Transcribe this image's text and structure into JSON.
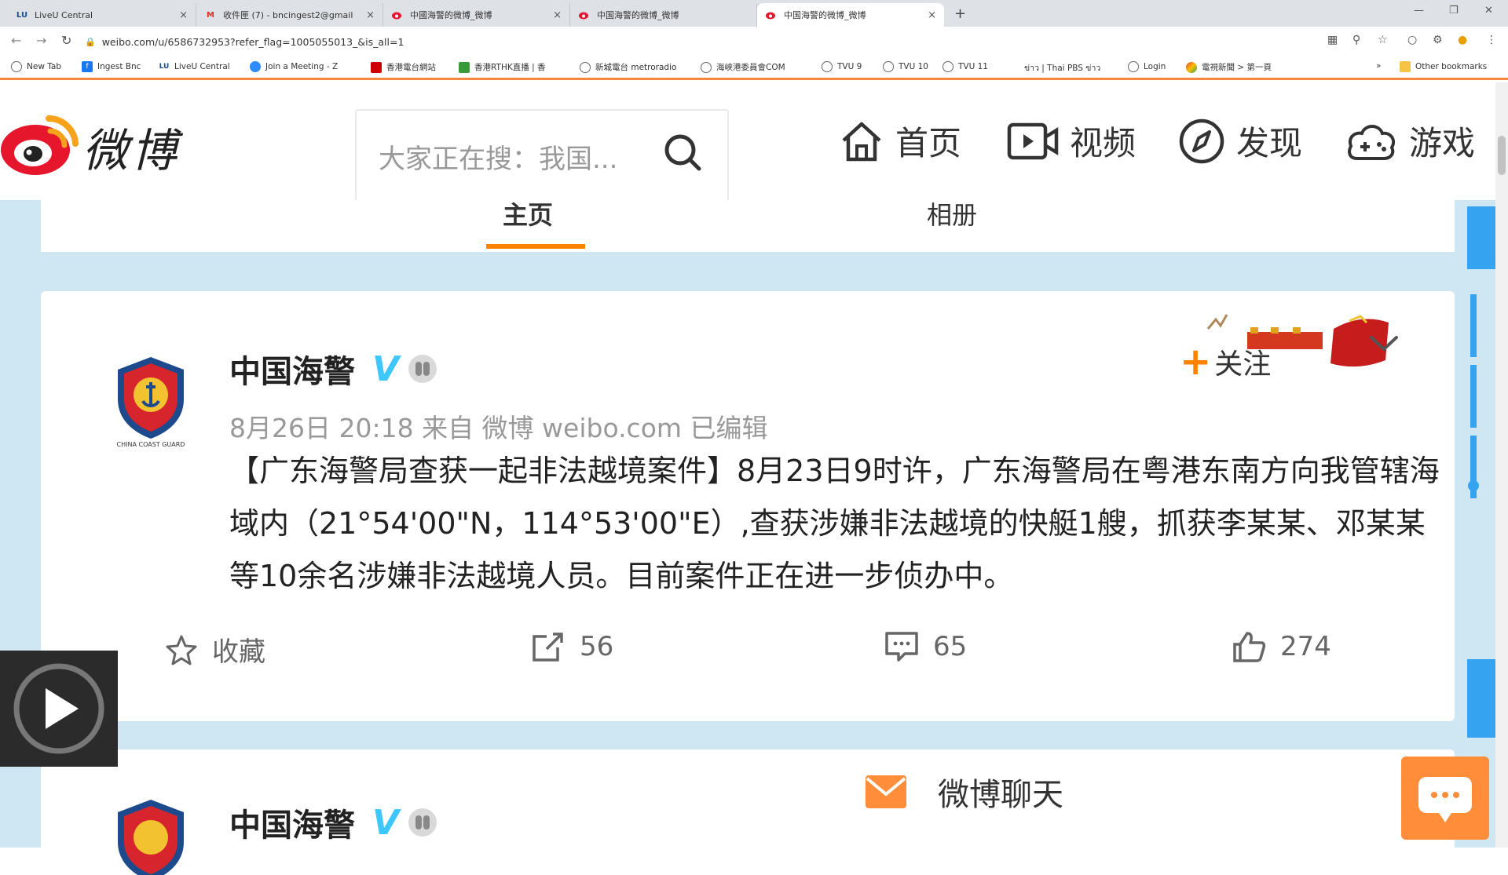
{
  "browser": {
    "tabs": [
      {
        "favicon": "LU",
        "title": "LiveU Central",
        "active": false
      },
      {
        "favicon": "M",
        "title": "收件匣 (7) - bncingest2@gmail",
        "active": false
      },
      {
        "favicon": "weibo",
        "title": "中國海警的微博_微博",
        "active": false
      },
      {
        "favicon": "weibo",
        "title": "中国海警的微博_微博",
        "active": false
      },
      {
        "favicon": "weibo",
        "title": "中国海警的微博_微博",
        "active": true
      }
    ],
    "new_tab": "+",
    "close": "×",
    "url": "weibo.com/u/6586732953?refer_flag=1005055013_&is_all=1",
    "bookmarks": [
      "New Tab",
      "Ingest Bnc",
      "LiveU Central",
      "Join a Meeting - Z",
      "香港電台網站",
      "香港RTHK直播 | 香",
      "新城電台 metroradio",
      "海峽港委員會COM",
      "TVU 9",
      "TVU 10",
      "TVU 11",
      "ข่าว | Thai PBS ข่าว",
      "Login",
      "電視新聞 > 第一頁"
    ],
    "bookmarks_more": "»",
    "other_bookmarks": "Other bookmarks",
    "accent_color": "#f4853a"
  },
  "weibo": {
    "logo_text": "微博",
    "search_placeholder": "大家正在搜：我国...",
    "nav": [
      {
        "icon": "home-icon",
        "label": "首页"
      },
      {
        "icon": "video-icon",
        "label": "视频"
      },
      {
        "icon": "discover-icon",
        "label": "发现"
      },
      {
        "icon": "game-icon",
        "label": "游戏"
      }
    ],
    "subtabs": {
      "home": "主页",
      "album": "相册"
    },
    "brand_color": "#ff8200"
  },
  "post1": {
    "username": "中国海警",
    "verified": "V",
    "meta": "8月26日 20:18 来自 微博 weibo.com   已编辑",
    "follow_label": "关注",
    "follow_plus": "+",
    "text": "【广东海警局查获一起非法越境案件】8月23日9时许，广东海警局在粤港东南方向我管辖海域内（21°54'00\"N，114°53'00\"E）,查获涉嫌非法越境的快艇1艘，抓获李某某、邓某某等10余名涉嫌非法越境人员。目前案件正在进一步侦办中。",
    "actions": {
      "favorite": "收藏",
      "repost": "56",
      "comment": "65",
      "like": "274"
    }
  },
  "post2": {
    "username": "中国海警",
    "verified": "V"
  },
  "chat_label": "微博聊天"
}
